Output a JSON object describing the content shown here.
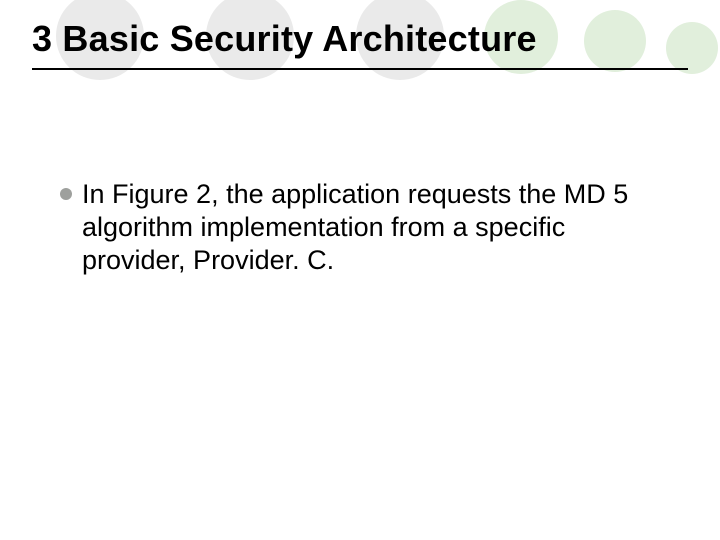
{
  "slide": {
    "title": "3 Basic Security Architecture",
    "bullets": [
      {
        "text": "In Figure 2, the application requests the MD 5 algorithm implementation from a specific provider, Provider. C."
      }
    ]
  }
}
